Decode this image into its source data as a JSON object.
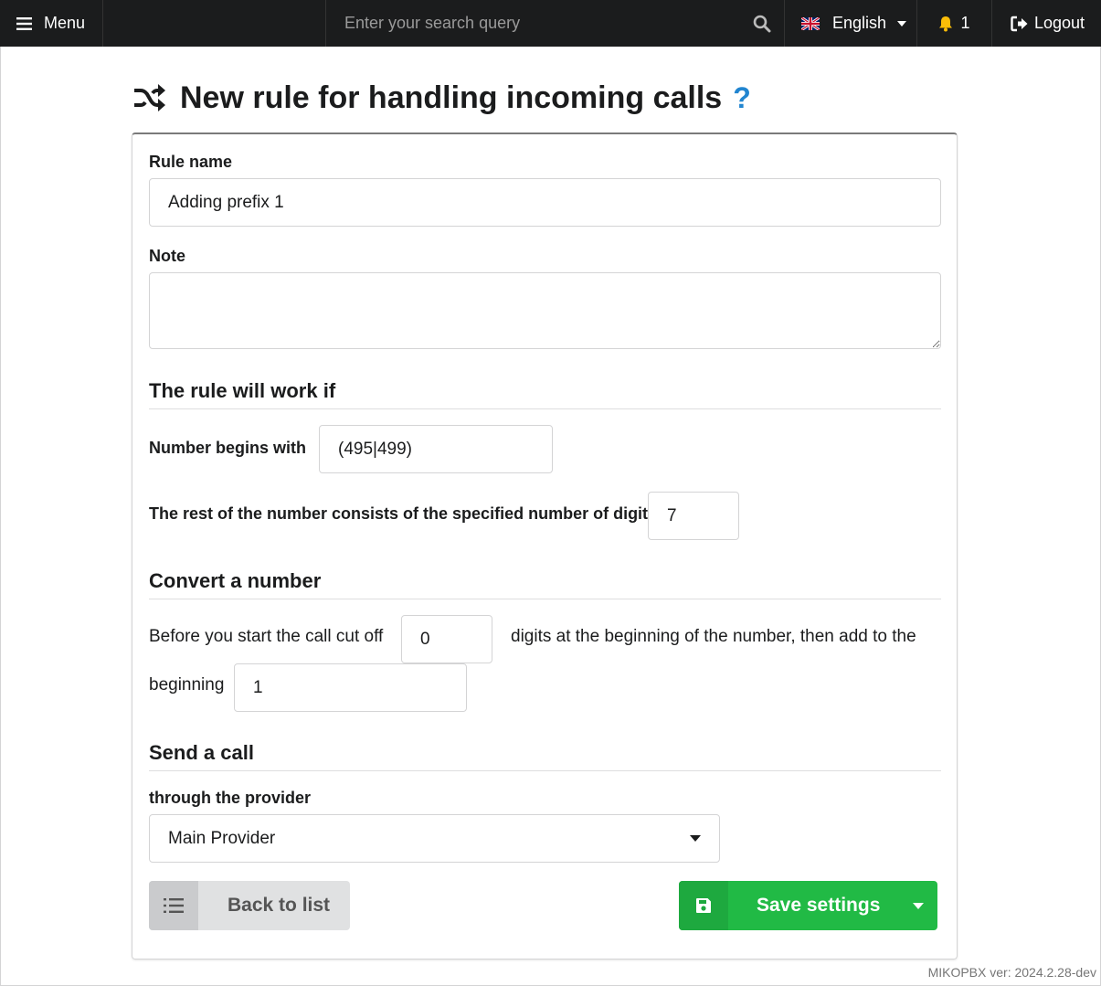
{
  "topbar": {
    "menu_label": "Menu",
    "search_placeholder": "Enter your search query",
    "language": "English",
    "notifications_count": "1",
    "logout_label": "Logout"
  },
  "header": {
    "title": "New rule for handling incoming calls",
    "help": "?"
  },
  "form": {
    "rule_name_label": "Rule name",
    "rule_name_value": "Adding prefix 1",
    "note_label": "Note",
    "note_value": "",
    "section_condition": "The rule will work if",
    "number_begins_label": "Number begins with",
    "number_begins_value": "(495|499)",
    "rest_digits_label": "The rest of the number consists of the specified number of digits",
    "rest_digits_value": "7",
    "section_convert": "Convert a number",
    "cut_off_text_before": "Before you start the call cut off",
    "cut_off_value": "0",
    "cut_off_text_after": "digits at the beginning of the number, then add to the",
    "prepend_text": "beginning",
    "prepend_value": "1",
    "section_send": "Send a call",
    "provider_label": "through the provider",
    "provider_value": "Main Provider"
  },
  "buttons": {
    "back_label": "Back to list",
    "save_label": "Save settings"
  },
  "footer": {
    "version": "MIKOPBX ver: 2024.2.28-dev"
  },
  "colors": {
    "topbar_bg": "#1b1c1d",
    "help_blue": "#2185d0",
    "save_green": "#21ba45",
    "bell_yellow": "#fbbd08"
  }
}
